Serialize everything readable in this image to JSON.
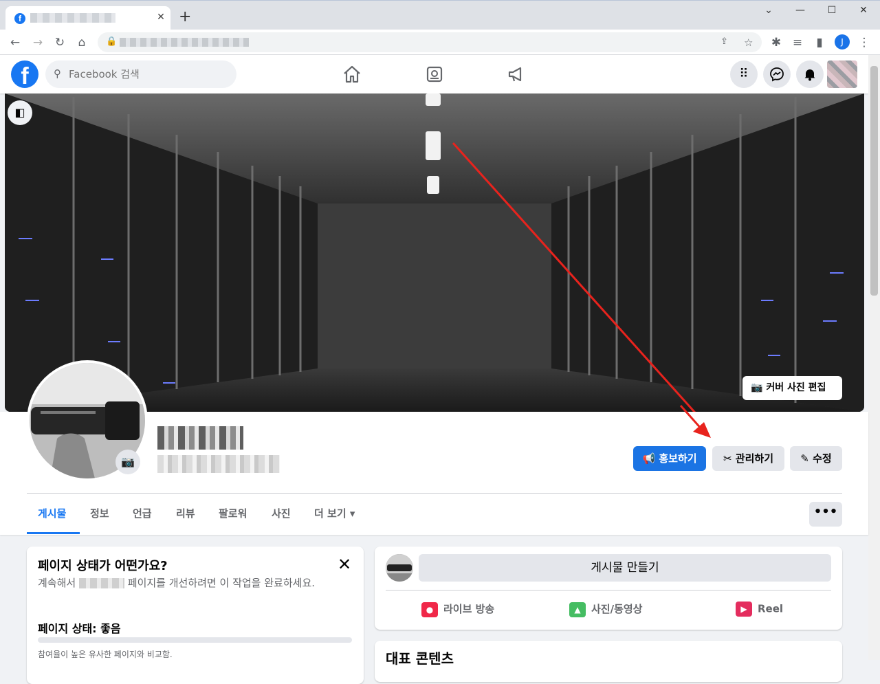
{
  "browser": {
    "new_tab_label": "+",
    "tab_close": "✕",
    "window_minimize": "⌄",
    "window_min": "—",
    "window_max": "☐",
    "window_close": "✕"
  },
  "fb_header": {
    "logo_letter": "f",
    "search_placeholder": "Facebook 검색"
  },
  "browser_avatar": "J",
  "cover": {
    "edit_label": "커버 사진 편집"
  },
  "actions": {
    "promote": "홍보하기",
    "manage": "관리하기",
    "edit": "수정"
  },
  "tabs": [
    {
      "label": "게시물"
    },
    {
      "label": "정보"
    },
    {
      "label": "언급"
    },
    {
      "label": "리뷰"
    },
    {
      "label": "팔로워"
    },
    {
      "label": "사진"
    },
    {
      "label": "더 보기 ▾"
    }
  ],
  "more_button": "•••",
  "page_status_card": {
    "title": "페이지 상태가 어떤가요?",
    "desc_before": "계속해서",
    "desc_after": "페이지를 개선하려면 이 작업을 완료하세요.",
    "status": "페이지 상태: 좋음",
    "compare": "참여율이 높은 유사한 페이지와 비교함."
  },
  "composer": {
    "create_label": "게시물 만들기",
    "live": "라이브 방송",
    "photo": "사진/동영상",
    "reel": "Reel"
  },
  "featured": {
    "title": "대표 콘텐츠"
  }
}
